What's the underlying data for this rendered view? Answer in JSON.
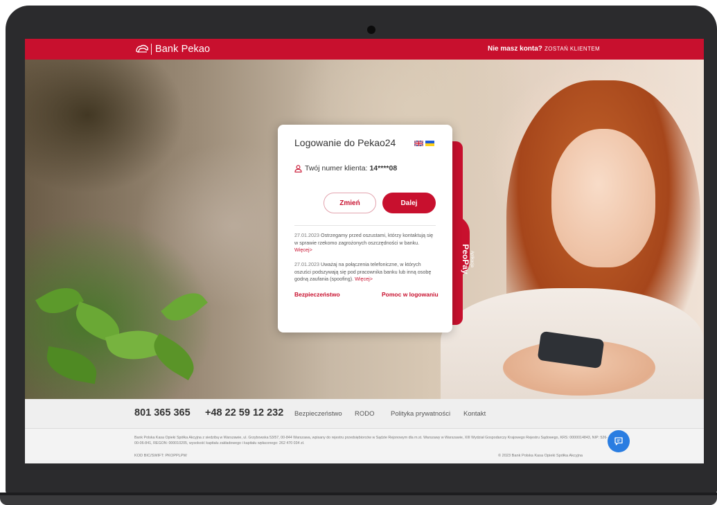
{
  "header": {
    "logo_text": "Bank Pekao",
    "no_account_text": "Nie masz konta?",
    "become_client_link": "ZOSTAŃ KLIENTEM"
  },
  "login_card": {
    "title": "Logowanie do Pekao24",
    "languages": [
      "en-flag-icon",
      "ua-flag-icon"
    ],
    "client_label": "Twój numer klienta:",
    "client_number": "14****08",
    "change_button": "Zmień",
    "next_button": "Dalej",
    "news": [
      {
        "date": "27.01.2023",
        "text": "Ostrzegamy przed oszustami, którzy kontaktują się w sprawie rzekomo zagrożonych oszczędności w banku.",
        "link": "Więcej>"
      },
      {
        "date": "27.01.2023",
        "text": "Uważaj na połączenia telefoniczne, w których oszuści podszywają się pod pracownika banku lub inną osobę godną zaufania (spoofing).",
        "link": "Więcej>"
      }
    ],
    "security_link": "Bezpieczeństwo",
    "help_link": "Pomoc w logowaniu"
  },
  "peopay_tab": {
    "small_text": "Aplikacja",
    "big_text": "PeoPay"
  },
  "footer": {
    "phone1": "801 365 365",
    "phone2": "+48 22 59 12 232",
    "links": [
      "Bezpieczeństwo",
      "RODO",
      "Polityka prywatności",
      "Kontakt"
    ],
    "legal": "Bank Polska Kasa Opieki Spółka Akcyjna z siedzibą w Warszawie, ul. Grzybowska 53/57, 00-844 Warszawa, wpisany do rejestru przedsiębiorców w Sądzie Rejonowym dla m.st. Warszawy w Warszawie, XIII Wydział Gospodarczy Krajowego Rejestru Sądowego, KRS: 0000014843, NIP: 526-00-06-841, REGON: 000010205, wysokość kapitału zakładowego i kapitału wpłaconego: 262 470 034 zł.",
    "swift": "KOD BIC/SWIFT: PKOPPLPW",
    "copyright": "© 2023 Bank Polska Kasa Opieki Spółka Akcyjna"
  },
  "colors": {
    "brand_red": "#c8102e",
    "chat_blue": "#2a7de1"
  }
}
